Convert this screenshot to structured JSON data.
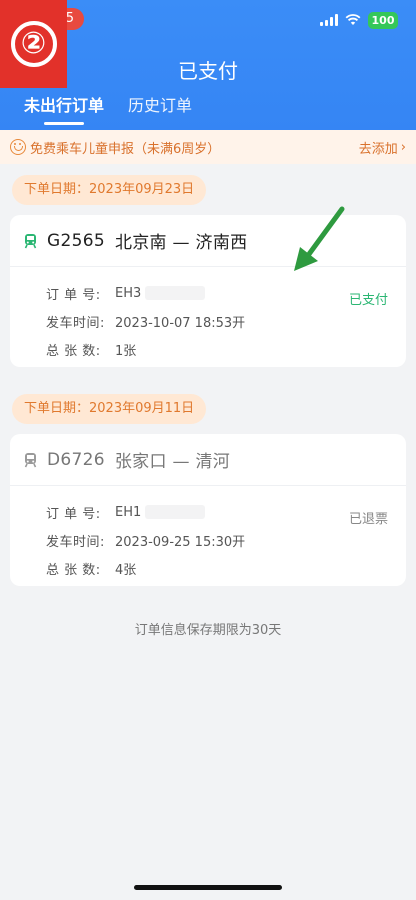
{
  "status_bar": {
    "time": "5",
    "battery": "100"
  },
  "step_marker": "②",
  "header": {
    "title": "已支付",
    "tabs": [
      {
        "label": "未出行订单",
        "active": true
      },
      {
        "label": "历史订单",
        "active": false
      }
    ]
  },
  "banner": {
    "text": "免费乘车儿童申报（未满6周岁）",
    "action": "去添加",
    "action_arrow": "›"
  },
  "orders": [
    {
      "date_label": "下单日期：2023年09月23日",
      "train": "G2565",
      "route": "北京南 — 济南西",
      "status": "已支付",
      "fields": [
        {
          "label": "订 单 号:",
          "value": "EH3"
        },
        {
          "label": "发车时间:",
          "value": "2023-10-07   18:53开"
        },
        {
          "label": "总 张 数:",
          "value": "1张"
        }
      ]
    },
    {
      "date_label": "下单日期：2023年09月11日",
      "train": "D6726",
      "route": "张家口 — 清河",
      "status": "已退票",
      "fields": [
        {
          "label": "订 单 号:",
          "value": "EH1"
        },
        {
          "label": "发车时间:",
          "value": "2023-09-25   15:30开"
        },
        {
          "label": "总 张 数:",
          "value": "4张"
        }
      ]
    }
  ],
  "footer_note": "订单信息保存期限为30天",
  "colors": {
    "primary": "#3585f4",
    "paid_green": "#2bb673",
    "orange": "#e0792e",
    "annotation_green": "#2e9a3f"
  }
}
